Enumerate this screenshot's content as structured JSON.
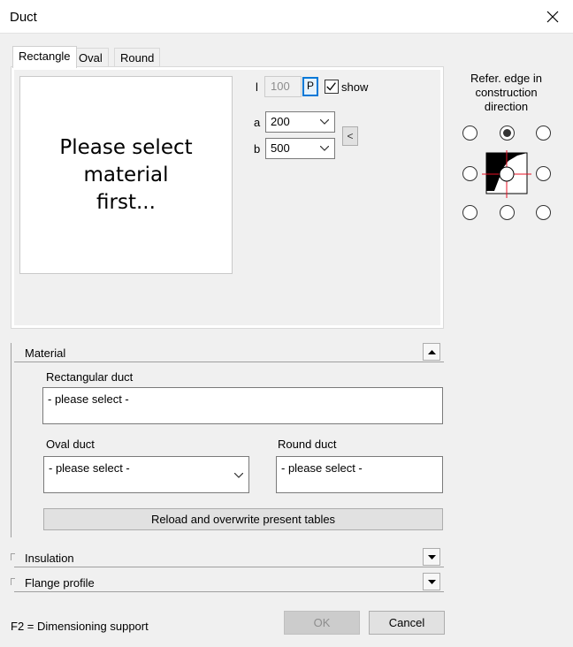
{
  "window": {
    "title": "Duct"
  },
  "tabs": [
    {
      "label": "Rectangle",
      "active": true
    },
    {
      "label": "Oval",
      "active": false
    },
    {
      "label": "Round",
      "active": false
    }
  ],
  "preview": {
    "line1": "Please select",
    "line2": "material",
    "line3": "first..."
  },
  "length": {
    "label": "l",
    "value": "100",
    "p_label": "P",
    "show_label": "show",
    "show_checked": true
  },
  "dims": {
    "a_label": "a",
    "a_value": "200",
    "b_label": "b",
    "b_value": "500",
    "arrow_label": "<"
  },
  "reference": {
    "line1": "Refer. edge in",
    "line2": "construction",
    "line3": "direction",
    "selected": "top-center"
  },
  "material": {
    "header": "Material",
    "rect_label": "Rectangular duct",
    "rect_value": "- please select -",
    "oval_label": "Oval duct",
    "oval_value": "- please select -",
    "round_label": "Round duct",
    "round_value": "- please select -",
    "reload_label": "Reload and overwrite present tables"
  },
  "insulation": {
    "header": "Insulation"
  },
  "flange": {
    "header": "Flange profile"
  },
  "footer": {
    "hint": "F2 = Dimensioning support",
    "ok_label": "OK",
    "cancel_label": "Cancel"
  },
  "colors": {
    "accent": "#0078d7",
    "crosshair": "#e81123"
  }
}
